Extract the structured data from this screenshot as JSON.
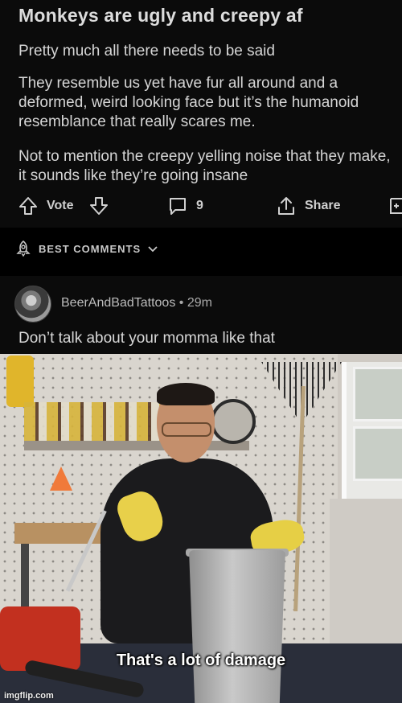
{
  "post": {
    "title": "Monkeys are ugly and creepy af",
    "paragraphs": [
      "Pretty much all there needs to be said",
      "They resemble us yet have fur all around and a deformed, weird looking face but it’s the humanoid resemblance that really scares me.",
      "Not to mention the creepy yelling noise that they make, it sounds like they’re going insane"
    ],
    "actions": {
      "vote_label": "Vote",
      "comment_count": "9",
      "share_label": "Share"
    }
  },
  "comments_header": {
    "label": "BEST COMMENTS"
  },
  "comment": {
    "author": "BeerAndBadTattoos",
    "separator": "•",
    "age": "29m",
    "text": "Don’t talk about your momma like that"
  },
  "meme": {
    "caption": "That's a lot of damage",
    "watermark": "imgflip.com"
  },
  "colors": {
    "background": "#0b0b0b",
    "text": "#d6d6d6",
    "muted": "#a9a9a9"
  }
}
